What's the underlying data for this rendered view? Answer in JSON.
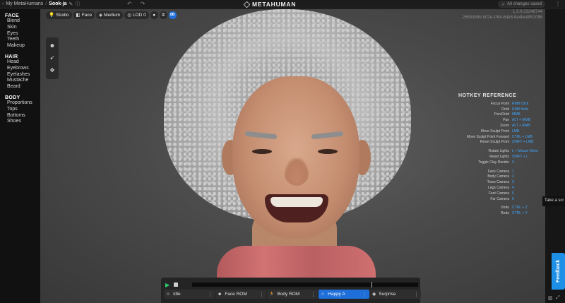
{
  "topbar": {
    "breadcrumb_parent": "My MetaHumans",
    "breadcrumb_sep": "/",
    "name": "Sook-ja",
    "logo_text": "METAHUMAN",
    "saved_status": "All changes saved"
  },
  "sidebar": {
    "face": {
      "heading": "FACE",
      "items": [
        "Blend",
        "Skin",
        "Eyes",
        "Teeth",
        "Makeup"
      ]
    },
    "hair": {
      "heading": "HAIR",
      "items": [
        "Head",
        "Eyebrows",
        "Eyelashes",
        "Mustache",
        "Beard"
      ]
    },
    "body": {
      "heading": "BODY",
      "items": [
        "Proportions",
        "Tops",
        "Bottoms",
        "Shoes"
      ]
    }
  },
  "viewport_toolbar": {
    "studio": "Studio",
    "face": "Face",
    "medium": "Medium",
    "lod": "LOD 0",
    "badge": "8B"
  },
  "version": {
    "line1": "1.3.0-23248744",
    "line2": "2663db9b-b02e-1f64-6de6-8a4bed851086"
  },
  "hotkeys": {
    "title": "HOTKEY REFERENCE",
    "groups": [
      [
        [
          "Focus Point",
          "RMB Click"
        ],
        [
          "Orbit",
          "RMB Hold"
        ],
        [
          "Pan/Orbit",
          "MMB"
        ],
        [
          "Pan",
          "ALT + MMB"
        ],
        [
          "Zoom",
          "ALT + RMB"
        ],
        [
          "Move Sculpt Point",
          "LMB"
        ],
        [
          "Move Sculpt Point Forward",
          "CTRL + LMB"
        ],
        [
          "Reset Sculpt Point",
          "SHIFT + LMB"
        ]
      ],
      [
        [
          "Rotate Lights",
          "L + Mouse Move"
        ],
        [
          "Reset Lights",
          "SHIFT + L"
        ],
        [
          "Toggle Clay Render",
          "C"
        ]
      ],
      [
        [
          "Face Camera",
          "1"
        ],
        [
          "Body Camera",
          "2"
        ],
        [
          "Torso Camera",
          "3"
        ],
        [
          "Legs Camera",
          "4"
        ],
        [
          "Feet Camera",
          "5"
        ],
        [
          "Far Camera",
          "6"
        ]
      ],
      [
        [
          "Undo",
          "CTRL + Z"
        ],
        [
          "Redo",
          "CTRL + Y"
        ]
      ]
    ]
  },
  "tooltip": "Take a scr",
  "feedback": "Feedback",
  "animations": [
    {
      "label": "Idle",
      "icon": "person-icon",
      "active": false
    },
    {
      "label": "Face ROM",
      "icon": "face-icon",
      "active": false
    },
    {
      "label": "Body ROM",
      "icon": "running-icon",
      "active": false
    },
    {
      "label": "Happy A",
      "icon": "happy-icon",
      "active": true
    },
    {
      "label": "Surprise",
      "icon": "surprise-icon",
      "active": false
    }
  ],
  "colors": {
    "accent": "#1e6fd9",
    "hotkey_value": "#3fa7ff",
    "play": "#2ecc71"
  }
}
